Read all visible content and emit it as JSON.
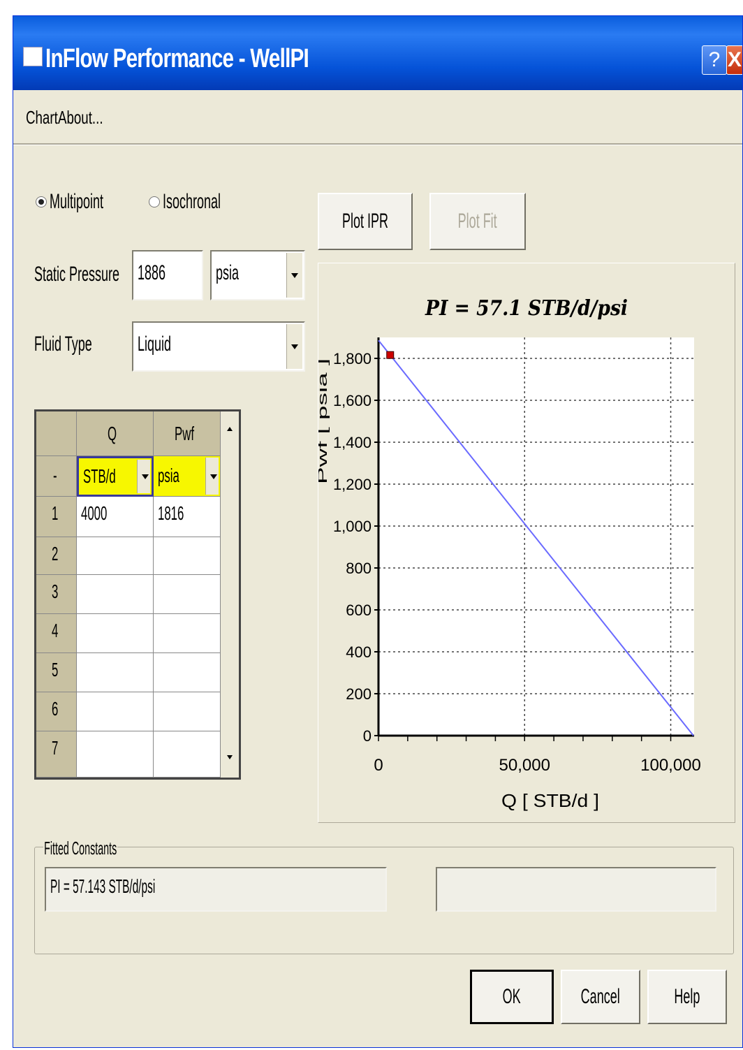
{
  "window": {
    "title": "InFlow Performance - WellPI",
    "help_glyph": "?",
    "close_glyph": "X"
  },
  "menu": [
    "Chart",
    "About..."
  ],
  "method": {
    "options": [
      "Multipoint",
      "Isochronal"
    ],
    "selected": "Multipoint"
  },
  "static_pressure": {
    "label": "Static Pressure",
    "value": "1886",
    "unit": "psia"
  },
  "fluid_type": {
    "label": "Fluid Type",
    "value": "Liquid"
  },
  "buttons": {
    "plot_ipr": "Plot IPR",
    "plot_fit": "Plot Fit",
    "ok": "OK",
    "cancel": "Cancel",
    "help": "Help"
  },
  "table": {
    "headers": [
      "Q",
      "Pwf"
    ],
    "unit_row_marker": "-",
    "units": [
      "STB/d",
      "psia"
    ],
    "rows": [
      {
        "num": "1",
        "q": "4000",
        "pwf": "1816"
      },
      {
        "num": "2",
        "q": "",
        "pwf": ""
      },
      {
        "num": "3",
        "q": "",
        "pwf": ""
      },
      {
        "num": "4",
        "q": "",
        "pwf": ""
      },
      {
        "num": "5",
        "q": "",
        "pwf": ""
      },
      {
        "num": "6",
        "q": "",
        "pwf": ""
      },
      {
        "num": "7",
        "q": "",
        "pwf": ""
      }
    ]
  },
  "fitted": {
    "label": "Fitted Constants",
    "value": "PI = 57.143 STB/d/psi",
    "second_value": ""
  },
  "chart_data": {
    "type": "line",
    "title": "PI = 57.1 STB/d/psi",
    "xlabel": "Q [ STB/d ]",
    "ylabel": "Pwf [ psia ]",
    "xlim": [
      0,
      108000
    ],
    "ylim": [
      0,
      1900
    ],
    "x_ticks": [
      0,
      50000,
      100000
    ],
    "x_tick_labels": [
      "0",
      "50,000",
      "100,000"
    ],
    "y_ticks": [
      0,
      200,
      400,
      600,
      800,
      1000,
      1200,
      1400,
      1600,
      1800
    ],
    "y_tick_labels": [
      "0",
      "200",
      "400",
      "600",
      "800",
      "1,000",
      "1,200",
      "1,400",
      "1,600",
      "1,800"
    ],
    "grid": true,
    "series": [
      {
        "type": "line",
        "x": [
          0,
          107771
        ],
        "y": [
          1886,
          0
        ],
        "color": "#6a6aff"
      },
      {
        "type": "scatter",
        "x": [
          4000
        ],
        "y": [
          1816
        ],
        "color": "#cc0000"
      }
    ]
  }
}
